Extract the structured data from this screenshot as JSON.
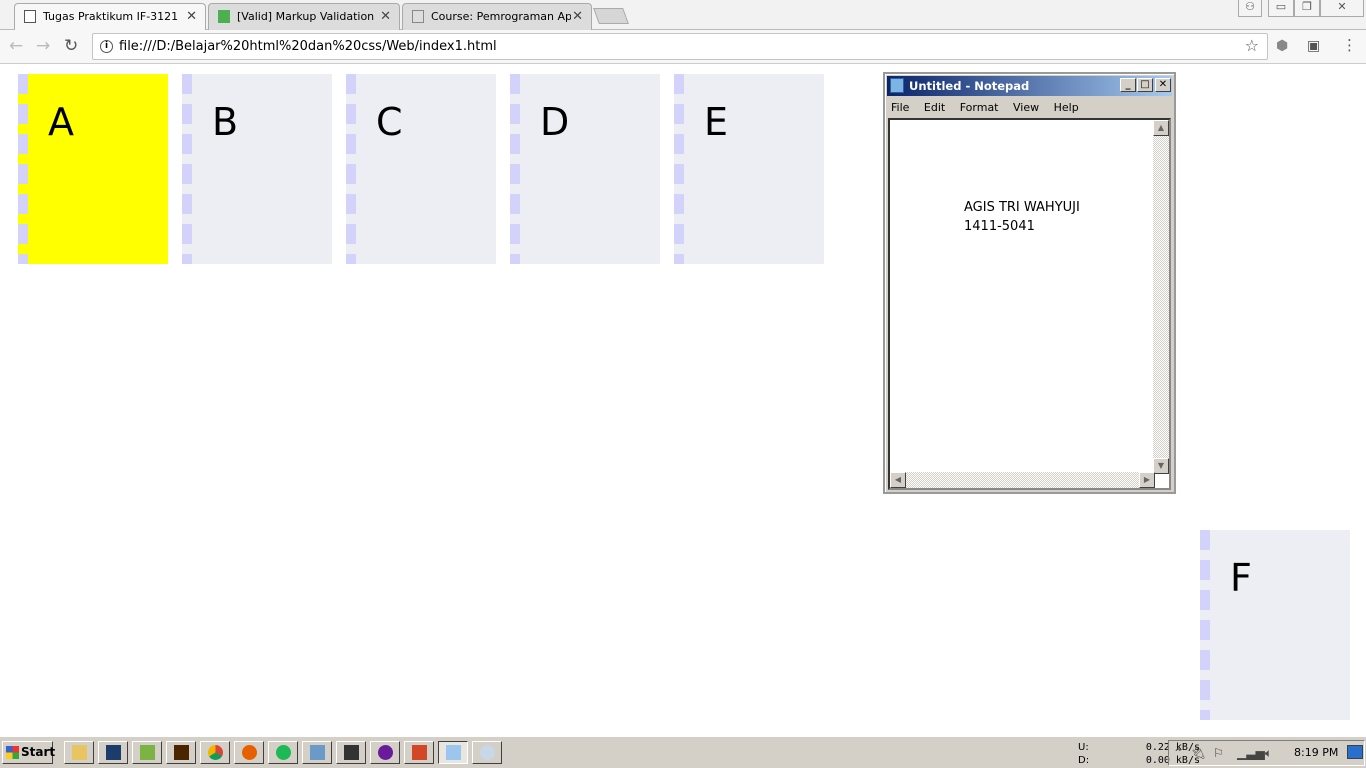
{
  "browser": {
    "tabs": [
      {
        "title": "Tugas Praktikum IF-3121",
        "active": true
      },
      {
        "title": "[Valid] Markup Validation of",
        "active": false
      },
      {
        "title": "Course: Pemrograman Aplik",
        "active": false
      }
    ],
    "url": "file:///D:/Belajar%20html%20dan%20css/Web/index1.html"
  },
  "page": {
    "boxes": [
      {
        "label": "A",
        "color": "#ffff00"
      },
      {
        "label": "B",
        "color": "#edeef3"
      },
      {
        "label": "C",
        "color": "#edeef3"
      },
      {
        "label": "D",
        "color": "#edeef3"
      },
      {
        "label": "E",
        "color": "#edeef3"
      },
      {
        "label": "F",
        "color": "#edeef3"
      }
    ]
  },
  "notepad": {
    "title": "Untitled - Notepad",
    "menu": [
      "File",
      "Edit",
      "Format",
      "View",
      "Help"
    ],
    "content": "AGIS TRI WAHYUJI\n1411-5041"
  },
  "taskbar": {
    "start_label": "Start",
    "upload_label": "U:",
    "upload_value": "0.22 kB/s",
    "download_label": "D:",
    "download_value": "0.00 kB/s",
    "clock": "8:19 PM"
  }
}
